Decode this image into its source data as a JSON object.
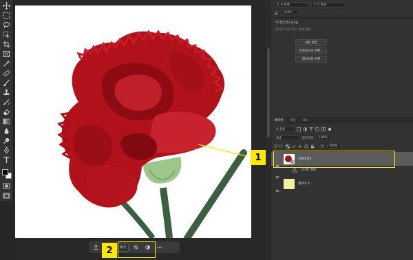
{
  "toolbar": {
    "tools": [
      {
        "name": "move-tool-icon"
      },
      {
        "name": "marquee-tool-icon"
      },
      {
        "name": "lasso-tool-icon"
      },
      {
        "name": "object-select-tool-icon"
      },
      {
        "name": "crop-tool-icon"
      },
      {
        "name": "frame-tool-icon"
      },
      {
        "name": "eyedropper-tool-icon"
      },
      {
        "name": "healing-brush-tool-icon"
      },
      {
        "name": "brush-tool-icon"
      },
      {
        "name": "clone-stamp-tool-icon"
      },
      {
        "name": "history-brush-tool-icon"
      },
      {
        "name": "eraser-tool-icon"
      },
      {
        "name": "gradient-tool-icon"
      },
      {
        "name": "blur-tool-icon"
      },
      {
        "name": "dodge-tool-icon"
      },
      {
        "name": "pen-tool-icon"
      },
      {
        "name": "type-tool-icon"
      },
      {
        "name": "path-select-tool-icon"
      },
      {
        "name": "rectangle-tool-icon"
      },
      {
        "name": "hand-tool-icon"
      },
      {
        "name": "zoom-tool-icon"
      }
    ]
  },
  "properties": {
    "x_label": "X:",
    "x_value": "0 픽셀",
    "y_label": "Y:",
    "y_value": "0 픽셀",
    "angle_value": "0.00°",
    "filename": "카네이션2.png",
    "subtext": "레이어 가로 조소 개체 변환",
    "buttons": [
      "내용 편집",
      "연결됨으로 변환...",
      "레이어로 변환"
    ]
  },
  "layers_panel": {
    "tabs": [
      "레이어",
      "채널",
      "패스"
    ],
    "active_tab": "레이어",
    "filter_label": "Q 종류",
    "blend_mode": "표준",
    "opacity_label": "불투명도:",
    "opacity_value": "100%",
    "lock_label": "잠그기:",
    "fill_label": "칠:",
    "fill_value": "100%",
    "layers": [
      {
        "name": "카네이션2",
        "selected": true
      },
      {
        "name": "스마트 필터",
        "selected": false
      },
      {
        "name": "레이어 0",
        "selected": false
      }
    ]
  },
  "taskbar": {
    "remove_bg_label": "배경 제거"
  },
  "annotations": {
    "callout_1": "1",
    "callout_2": "2"
  },
  "colors": {
    "accent_yellow": "#ffe800",
    "panel_bg": "#323232",
    "selected_layer_bg": "#5c5c5c",
    "carnation_red": "#b0111a"
  }
}
